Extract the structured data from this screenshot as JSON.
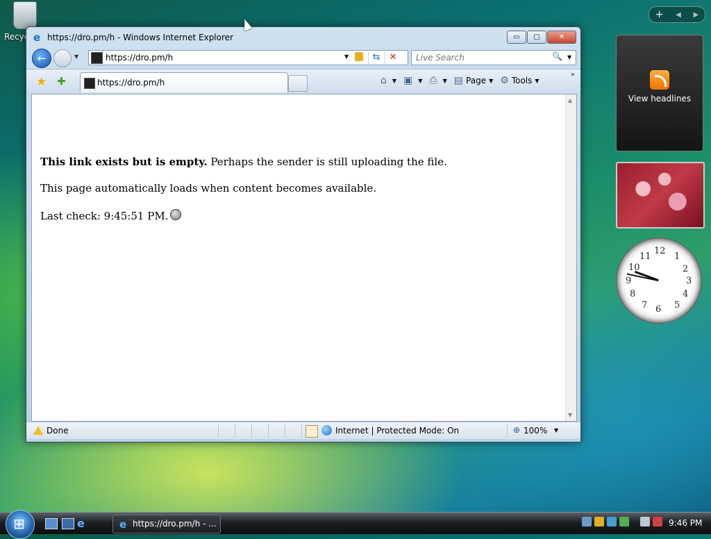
{
  "desktop": {
    "recycle_bin_label": "Recycle Bin"
  },
  "sidebar": {
    "controls": [
      "+",
      "◀",
      "▶"
    ],
    "feed_gadget_label": "View headlines",
    "clock_numbers": [
      "12",
      "1",
      "2",
      "3",
      "4",
      "5",
      "6",
      "7",
      "8",
      "9",
      "10",
      "11"
    ]
  },
  "browser": {
    "title": "https://dro.pm/h - Windows Internet Explorer",
    "window_buttons": {
      "minimize": "▭",
      "maximize": "▢",
      "close": "✕"
    },
    "address": "https://dro.pm/h",
    "search_placeholder": "Live Search",
    "tab_title": "https://dro.pm/h",
    "command_bar": {
      "page": "Page",
      "tools": "Tools"
    },
    "content": {
      "line1_bold": "This link exists but is empty.",
      "line1_rest": " Perhaps the sender is still uploading the file.",
      "line2": "This page automatically loads when content becomes available.",
      "line3": "Last check: 9:45:51 PM."
    },
    "status": {
      "text": "Done",
      "zone": "Internet | Protected Mode: On",
      "zoom": "100%"
    }
  },
  "taskbar": {
    "task_label": "https://dro.pm/h - ...",
    "clock": "9:46 PM"
  },
  "colors": {
    "window_frame": "#bcd3e6",
    "close_button": "#c8452c",
    "taskbar": "#1c2024"
  }
}
